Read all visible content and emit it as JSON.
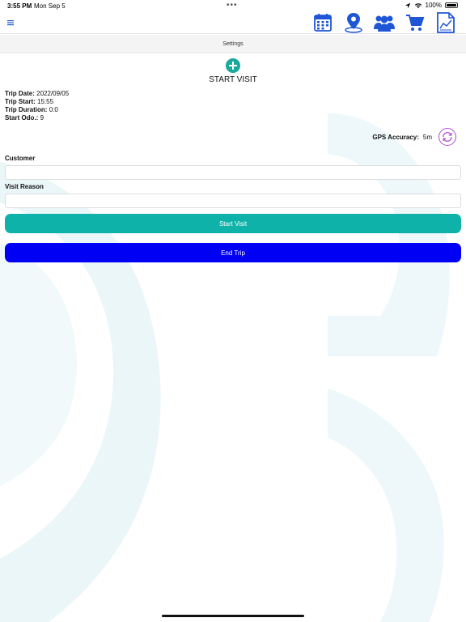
{
  "status_bar": {
    "time": "3:55 PM",
    "date": "Mon Sep 5",
    "dots": "•••",
    "battery": "100%"
  },
  "header": {
    "menu_icon": "hamburger-icon",
    "icons": [
      "calendar-icon",
      "map-pin-icon",
      "customers-icon",
      "cart-icon",
      "report-icon"
    ],
    "accent_color": "#1e56d6"
  },
  "settings": {
    "label": "Settings"
  },
  "visit": {
    "add_icon": "plus-circle-icon",
    "title": "START VISIT"
  },
  "trip": {
    "date_label": "Trip Date:",
    "date_value": "2022/09/05",
    "start_label": "Trip Start:",
    "start_value": "15:55",
    "duration_label": "Trip Duration:",
    "duration_value": "0:0",
    "odo_label": "Start Odo.:",
    "odo_value": "9"
  },
  "gps": {
    "label": "GPS Accuracy:",
    "value": "5m",
    "refresh_icon": "refresh-icon"
  },
  "form": {
    "customer_label": "Customer",
    "customer_value": "",
    "customer_placeholder": "",
    "reason_label": "Visit Reason",
    "reason_value": "",
    "reason_placeholder": ""
  },
  "buttons": {
    "start_visit": "Start Visit",
    "end_trip": "End Trip",
    "start_color": "#0fb2a8",
    "end_color": "#0000f5"
  }
}
